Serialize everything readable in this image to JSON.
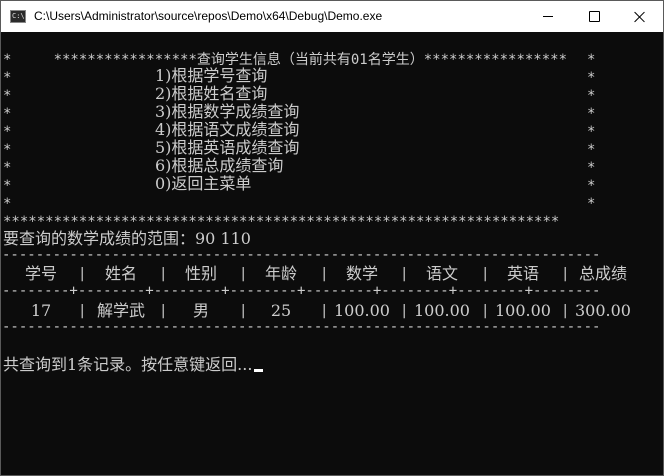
{
  "window": {
    "title": "C:\\Users\\Administrator\\source\\repos\\Demo\\x64\\Debug\\Demo.exe",
    "app_icon_text": "C:\\"
  },
  "console": {
    "header_line": "*****************查询学生信息（当前共有01名学生）*****************",
    "menu": [
      "1)根据学号查询",
      "2)根据姓名查询",
      "3)根据数学成绩查询",
      "4)根据语文成绩查询",
      "5)根据英语成绩查询",
      "6)根据总成绩查询",
      "0)返回主菜单"
    ],
    "side_star": "*",
    "footer_stars": "******************************************************************",
    "range_prompt": "要查询的数学成绩的范围：90 110",
    "table": {
      "top_rule": "-----------------------------------------------------------------------",
      "mid_rule": "--------+--------+--------+--------+--------+--------+--------+--------",
      "bottom_rule": "-----------------------------------------------------------------------",
      "headers": [
        "学号",
        "姓名",
        "性别",
        "年龄",
        "数学",
        "语文",
        "英语",
        "总成绩"
      ],
      "rows": [
        [
          "17",
          "解学武",
          "男",
          "25",
          "100.00",
          "100.00",
          "100.00",
          "300.00"
        ]
      ]
    },
    "result_text": "共查询到1条记录。按任意键返回..."
  }
}
